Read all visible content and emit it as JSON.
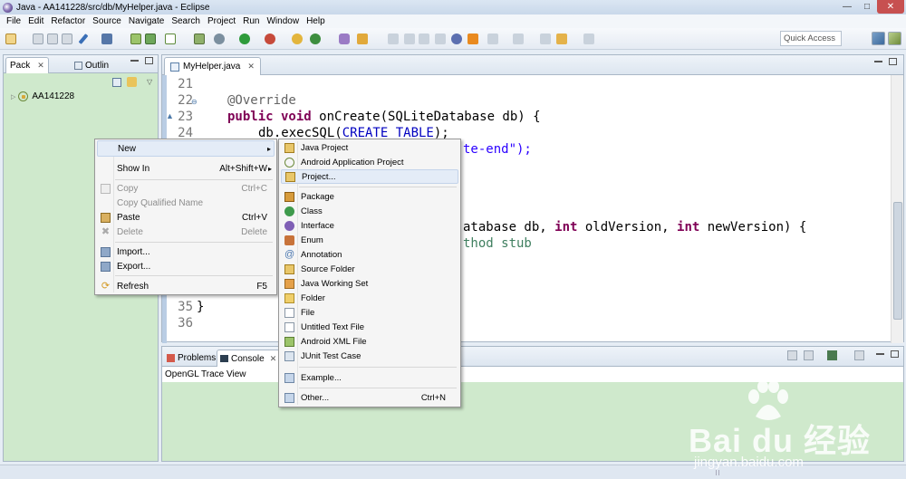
{
  "window": {
    "title": "Java - AA141228/src/db/MyHelper.java - Eclipse",
    "controls": [
      "—",
      "□",
      "✕"
    ]
  },
  "menubar": [
    "File",
    "Edit",
    "Refactor",
    "Source",
    "Navigate",
    "Search",
    "Project",
    "Run",
    "Window",
    "Help"
  ],
  "toolbar": {
    "quick_access_placeholder": "Quick Access"
  },
  "left_pane": {
    "tabs": [
      {
        "label": "Pack",
        "close": "✕"
      },
      {
        "label": "Outlin"
      }
    ],
    "tree": [
      {
        "label": "AA141228"
      }
    ]
  },
  "editor": {
    "tab_label": "MyHelper.java",
    "tab_close": "✕",
    "lines": [
      {
        "num": "21"
      },
      {
        "num": "22",
        "annotation": "@Override"
      },
      {
        "num": "23",
        "kw": "public void",
        "text": " onCreate(SQLiteDatabase db) {"
      },
      {
        "num": "24",
        "obj": "db.execSQL(",
        "field": "CREATE_TABLE",
        "rest": ");"
      },
      {
        "str_tail": "te-end\");"
      },
      {
        "frag_mid": "atabase db, ",
        "kw2": "int",
        "frag2": " oldVersion, ",
        "kw3": "int",
        "frag3": " newVersion) {"
      },
      {
        "comment_tail": "thod stub"
      },
      {
        "num": "35",
        "text": "}"
      },
      {
        "num": "36"
      }
    ]
  },
  "bottom_pane": {
    "tabs": [
      {
        "label": "Problems"
      },
      {
        "label": "Console",
        "close": "✕"
      }
    ],
    "console_title": "OpenGL Trace View"
  },
  "context_menu": {
    "items": [
      {
        "label": "New",
        "submenu": "▸",
        "highlighted": true
      },
      {
        "label": "Show In",
        "shortcut": "Alt+Shift+W",
        "submenu": "▸"
      },
      {
        "label": "Copy",
        "shortcut": "Ctrl+C",
        "disabled": true
      },
      {
        "label": "Copy Qualified Name",
        "disabled": true
      },
      {
        "label": "Paste",
        "shortcut": "Ctrl+V"
      },
      {
        "label": "Delete",
        "shortcut": "Delete",
        "disabled": true
      },
      {
        "label": "Import..."
      },
      {
        "label": "Export..."
      },
      {
        "label": "Refresh",
        "shortcut": "F5"
      }
    ]
  },
  "new_submenu": {
    "items": [
      {
        "label": "Java Project"
      },
      {
        "label": "Android Application Project"
      },
      {
        "label": "Project...",
        "highlighted": true
      },
      {
        "label": "Package"
      },
      {
        "label": "Class"
      },
      {
        "label": "Interface"
      },
      {
        "label": "Enum"
      },
      {
        "label": "Annotation"
      },
      {
        "label": "Source Folder"
      },
      {
        "label": "Java Working Set"
      },
      {
        "label": "Folder"
      },
      {
        "label": "File"
      },
      {
        "label": "Untitled Text File"
      },
      {
        "label": "Android XML File"
      },
      {
        "label": "JUnit Test Case"
      },
      {
        "label": "Example..."
      },
      {
        "label": "Other...",
        "shortcut": "Ctrl+N"
      }
    ]
  },
  "watermark": {
    "brand": "Bai du 经验",
    "url": "jingyan.baidu.com"
  },
  "colors": {
    "view_background": "#cfe9cc",
    "menu_highlight": "#e4ecf7",
    "keyword": "#7f0055",
    "field": "#0000c0",
    "string": "#2a00ff",
    "comment": "#3f7f5f"
  }
}
